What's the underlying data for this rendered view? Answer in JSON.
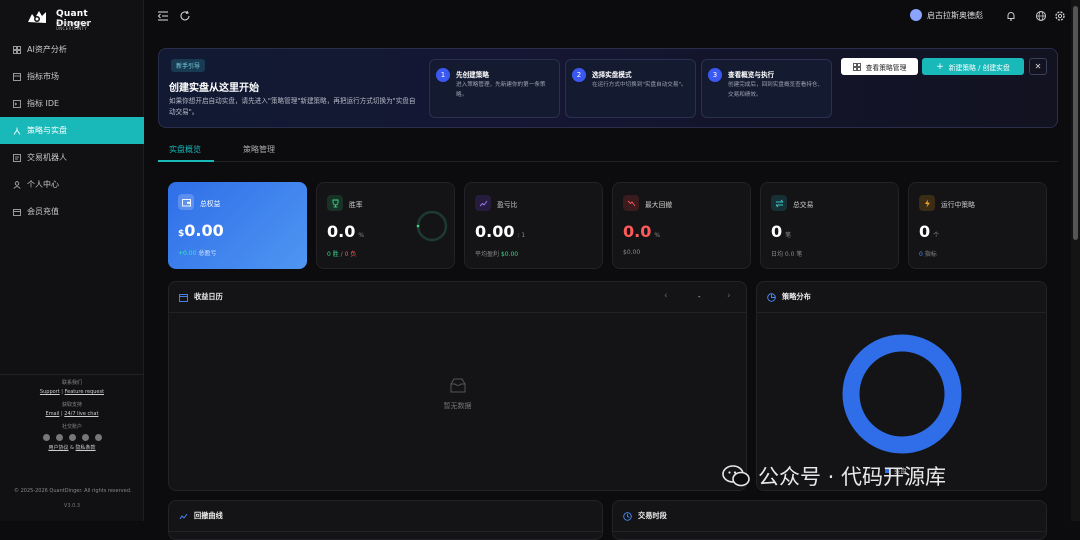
{
  "app": {
    "name": "Quant Dinger",
    "tagline": "CLARITY FROM UNCERTAINTY",
    "accent": "#19b9b9"
  },
  "sidebar": {
    "items": [
      {
        "label": "AI资产分析",
        "icon": "grid-icon"
      },
      {
        "label": "指标市场",
        "icon": "store-icon"
      },
      {
        "label": "指标 IDE",
        "icon": "code-icon"
      },
      {
        "label": "策略与实盘",
        "icon": "strategy-icon",
        "active": true
      },
      {
        "label": "交易机器人",
        "icon": "robot-icon"
      },
      {
        "label": "个人中心",
        "icon": "user-icon"
      },
      {
        "label": "会员充值",
        "icon": "wallet-icon"
      }
    ],
    "footer": {
      "contact_title": "联系我们",
      "support": "Support",
      "feature_request": "Feature request",
      "help_title": "获取支持",
      "email": "Email",
      "live_chat": "24/7 live chat",
      "social_title": "社交账户",
      "user_agreement": "用户协议",
      "privacy": "隐私条款",
      "and": "&",
      "copyright": "© 2025-2026 QuantDinger. All rights reserved.",
      "version": "V3.0.3"
    }
  },
  "topbar": {
    "user_name": "启古拉斯奥德彪"
  },
  "guide": {
    "badge": "新手引导",
    "title": "创建实盘从这里开始",
    "desc": "如果你想开启自动实盘，请先进入\"策略管理\"新建策略，再把运行方式切换为\"实盘自动交易\"。",
    "steps": [
      {
        "num": "1",
        "title": "先创建策略",
        "desc": "进入策略管理，先新建你的第一条策略。"
      },
      {
        "num": "2",
        "title": "选择实盘模式",
        "desc": "在运行方式中切换到\"实盘自动交易\"。"
      },
      {
        "num": "3",
        "title": "查看概览与执行",
        "desc": "创建完成后，回到实盘概览查看持仓、交易和绩效。"
      }
    ],
    "view_button": "查看策略管理",
    "new_button": "新建策略 / 创建实盘"
  },
  "tabs": [
    {
      "label": "实盘概览",
      "active": true
    },
    {
      "label": "策略管理"
    }
  ],
  "stats": [
    {
      "label": "总权益",
      "currency": "$",
      "value": "0.00",
      "sub_value": "+0.00",
      "sub_label": "总盈亏",
      "icon": "wallet-icon",
      "icon_color": "#ffffff"
    },
    {
      "label": "胜率",
      "value": "0.0",
      "unit": "%",
      "sub": "0 胜",
      "sub_sep": "/",
      "sub2": "0 负",
      "icon": "trophy-icon",
      "icon_color": "#39d98a",
      "win_ratio": 0
    },
    {
      "label": "盈亏比",
      "value": "0.00",
      "unit": ": 1",
      "sub_label": "平均盈利",
      "sub_value": "$0.00",
      "icon": "trend-up-icon",
      "icon_color": "#a77bff"
    },
    {
      "label": "最大回撤",
      "value": "0.0",
      "unit": "%",
      "sub": "$0.00",
      "icon": "trend-down-icon",
      "icon_color": "#ff5a5a"
    },
    {
      "label": "总交易",
      "value": "0",
      "unit": "笔",
      "sub": "日均 0.0 笔",
      "icon": "swap-icon",
      "icon_color": "#3ac7c7"
    },
    {
      "label": "运行中策略",
      "value": "0",
      "unit": "个",
      "sub_value": "0",
      "sub_label": "指标",
      "icon": "bolt-icon",
      "icon_color": "#f5a623"
    }
  ],
  "calendar": {
    "title": "收益日历",
    "month": "-",
    "empty": "暂无数据"
  },
  "distribution": {
    "title": "策略分布",
    "legend": "实盘"
  },
  "bottom": {
    "curve_title": "回撤曲线",
    "time_title": "交易时段"
  },
  "watermark": "公众号 · 代码开源库"
}
